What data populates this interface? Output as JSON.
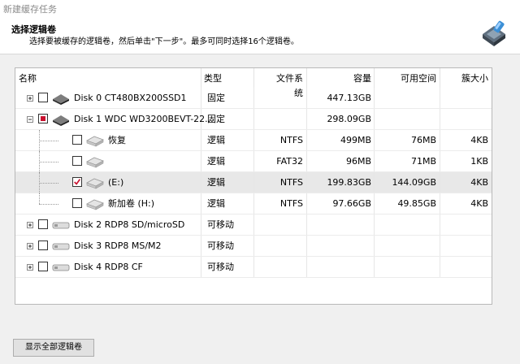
{
  "window": {
    "title": "新建缓存任务"
  },
  "header": {
    "title": "选择逻辑卷",
    "subtitle": "选择要被缓存的逻辑卷，然后单击\"下一步\"。最多可同时选择16个逻辑卷。"
  },
  "table": {
    "columns": [
      "名称",
      "类型",
      "文件系统",
      "容量",
      "可用空间",
      "簇大小"
    ],
    "rows": [
      {
        "name": "Disk 0 CT480BX200SSD1",
        "type": "固定",
        "fs": "",
        "capacity": "447.13GB",
        "free": "",
        "cluster": "",
        "level": 0,
        "checked": false,
        "icon": "hdd-icon"
      },
      {
        "name": "Disk 1 WDC WD3200BEVT-22...",
        "type": "固定",
        "fs": "",
        "capacity": "298.09GB",
        "free": "",
        "cluster": "",
        "level": 0,
        "checked": "partial",
        "icon": "hdd-icon"
      },
      {
        "name": "恢复",
        "type": "逻辑",
        "fs": "NTFS",
        "capacity": "499MB",
        "free": "76MB",
        "cluster": "4KB",
        "level": 1,
        "checked": false,
        "icon": "volume-icon"
      },
      {
        "name": "",
        "type": "逻辑",
        "fs": "FAT32",
        "capacity": "96MB",
        "free": "71MB",
        "cluster": "1KB",
        "level": 1,
        "checked": false,
        "icon": "volume-icon"
      },
      {
        "name": "(E:)",
        "type": "逻辑",
        "fs": "NTFS",
        "capacity": "199.83GB",
        "free": "144.09GB",
        "cluster": "4KB",
        "level": 1,
        "checked": true,
        "selected": true,
        "icon": "volume-icon"
      },
      {
        "name": "新加卷 (H:)",
        "type": "逻辑",
        "fs": "NTFS",
        "capacity": "97.66GB",
        "free": "49.85GB",
        "cluster": "4KB",
        "level": 1,
        "checked": false,
        "icon": "volume-icon"
      },
      {
        "name": "Disk 2 RDP8   SD/microSD",
        "type": "可移动",
        "fs": "",
        "capacity": "",
        "free": "",
        "cluster": "",
        "level": 0,
        "checked": false,
        "icon": "usb-drive-icon"
      },
      {
        "name": "Disk 3 RDP8   MS/M2",
        "type": "可移动",
        "fs": "",
        "capacity": "",
        "free": "",
        "cluster": "",
        "level": 0,
        "checked": false,
        "icon": "usb-drive-icon"
      },
      {
        "name": "Disk 4 RDP8   CF",
        "type": "可移动",
        "fs": "",
        "capacity": "",
        "free": "",
        "cluster": "",
        "level": 0,
        "checked": false,
        "icon": "usb-drive-icon"
      }
    ]
  },
  "buttons": {
    "show_all": "显示全部逻辑卷"
  },
  "colors": {
    "check_red": "#c8102e",
    "selected_row": "#e8e8e8"
  }
}
